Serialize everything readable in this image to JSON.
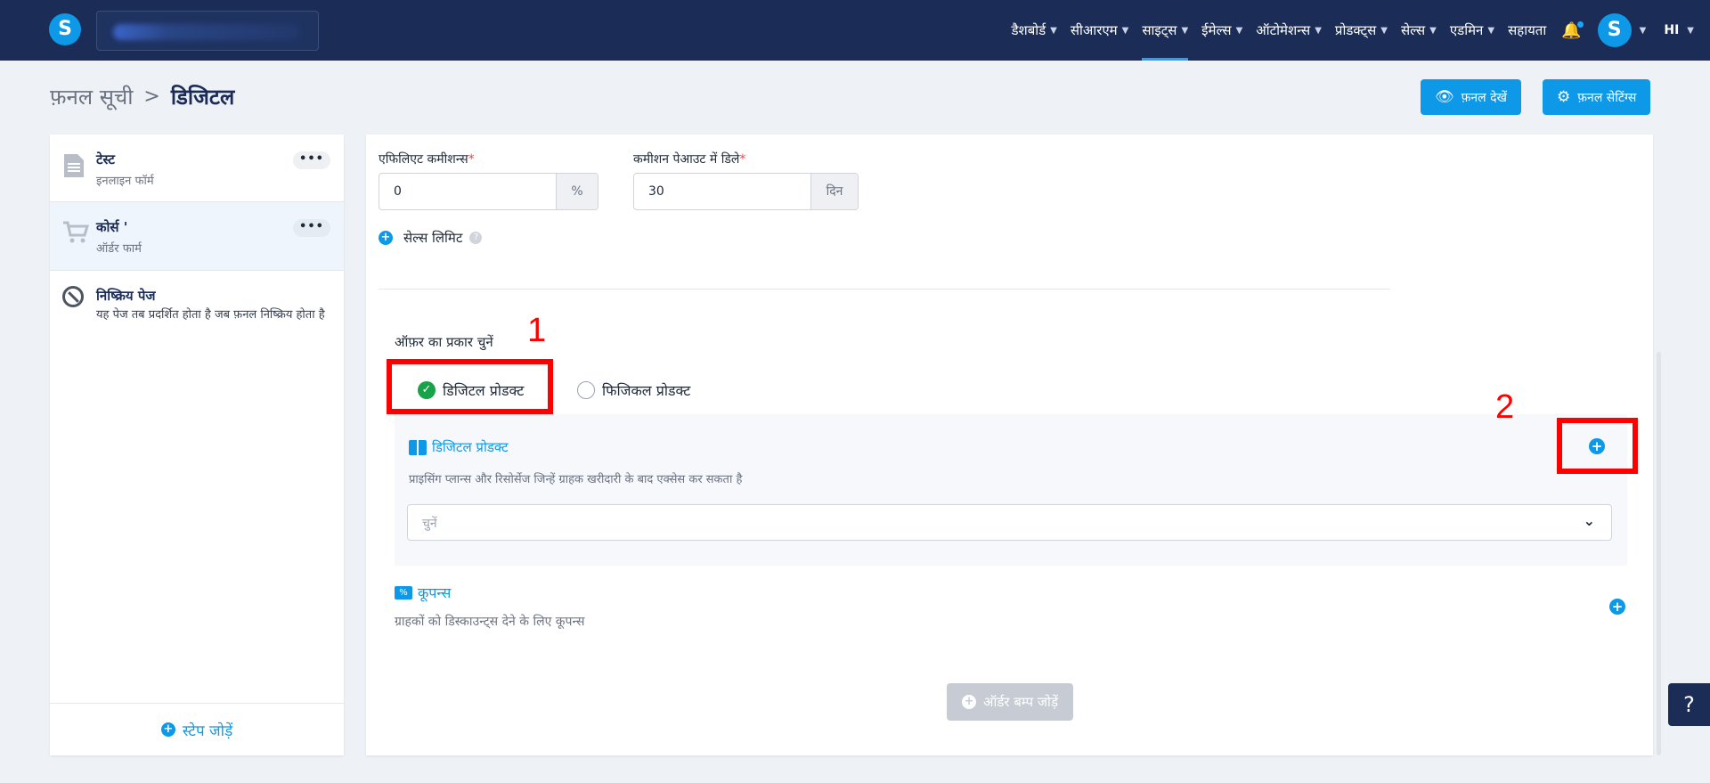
{
  "topbar": {
    "nav": [
      {
        "label": "डैशबोर्ड",
        "active": false
      },
      {
        "label": "सीआरएम",
        "active": false
      },
      {
        "label": "साइट्स",
        "active": true
      },
      {
        "label": "ईमेल्स",
        "active": false
      },
      {
        "label": "ऑटोमेशन्स",
        "active": false
      },
      {
        "label": "प्रोडक्ट्स",
        "active": false
      },
      {
        "label": "सेल्स",
        "active": false
      },
      {
        "label": "एडमिन",
        "active": false
      }
    ],
    "help_label": "सहायता",
    "logo_letter": "S",
    "avatar_letter": "S",
    "language": "HI"
  },
  "breadcrumb": {
    "first": "फ़नल सूची",
    "separator": ">",
    "current": "डिजिटल"
  },
  "header_buttons": {
    "view": "फ़नल देखें",
    "settings": "फ़नल सेटिंग्स"
  },
  "sidebar": {
    "steps": [
      {
        "title": "टेस्ट",
        "subtitle": "इनलाइन फॉर्म",
        "icon": "document-icon"
      },
      {
        "title": "कोर्स '",
        "subtitle": "ऑर्डर फार्म",
        "icon": "cart-icon"
      },
      {
        "title": "निष्क्रिय पेज",
        "subtitle": "यह पेज तब प्रदर्शित होता है जब फ़नल निष्क्रिय होता है",
        "icon": "no-entry-icon"
      }
    ],
    "more_label": "•••",
    "add_step": "स्टेप जोड़ें"
  },
  "form": {
    "commission_label": "एफिलिएट कमीशन्स",
    "commission_value": "0",
    "commission_suffix": "%",
    "payout_label": "कमीशन पेआउट में डिले",
    "payout_value": "30",
    "payout_suffix": "दिन",
    "required_mark": "*",
    "sales_limit": "सेल्स लिमिट",
    "help_mark": "?"
  },
  "offer": {
    "label": "ऑफ़र का प्रकार चुनें",
    "options": [
      {
        "label": "डिजिटल प्रोडक्ट",
        "selected": true
      },
      {
        "label": "फिजिकल प्रोडक्ट",
        "selected": false
      }
    ]
  },
  "digital_product": {
    "title": "डिजिटल प्रोडक्ट",
    "subtitle": "प्राइसिंग प्लान्स और रिसोर्सेज जिन्हें ग्राहक खरीदारी के बाद एक्सेस कर सकता है",
    "select_placeholder": "चुनें"
  },
  "coupons": {
    "title": "कूपन्स",
    "subtitle": "ग्राहकों को डिस्काउन्ट्स देने के लिए कूपन्स"
  },
  "order_bump_button": "ऑर्डर बम्प जोड़ें",
  "annotations": [
    "1",
    "2"
  ],
  "help_button": "?",
  "colors": {
    "nav_bg": "#1b2d57",
    "accent": "#0d99e8",
    "success": "#16a34a",
    "annotation": "#ff0000"
  }
}
